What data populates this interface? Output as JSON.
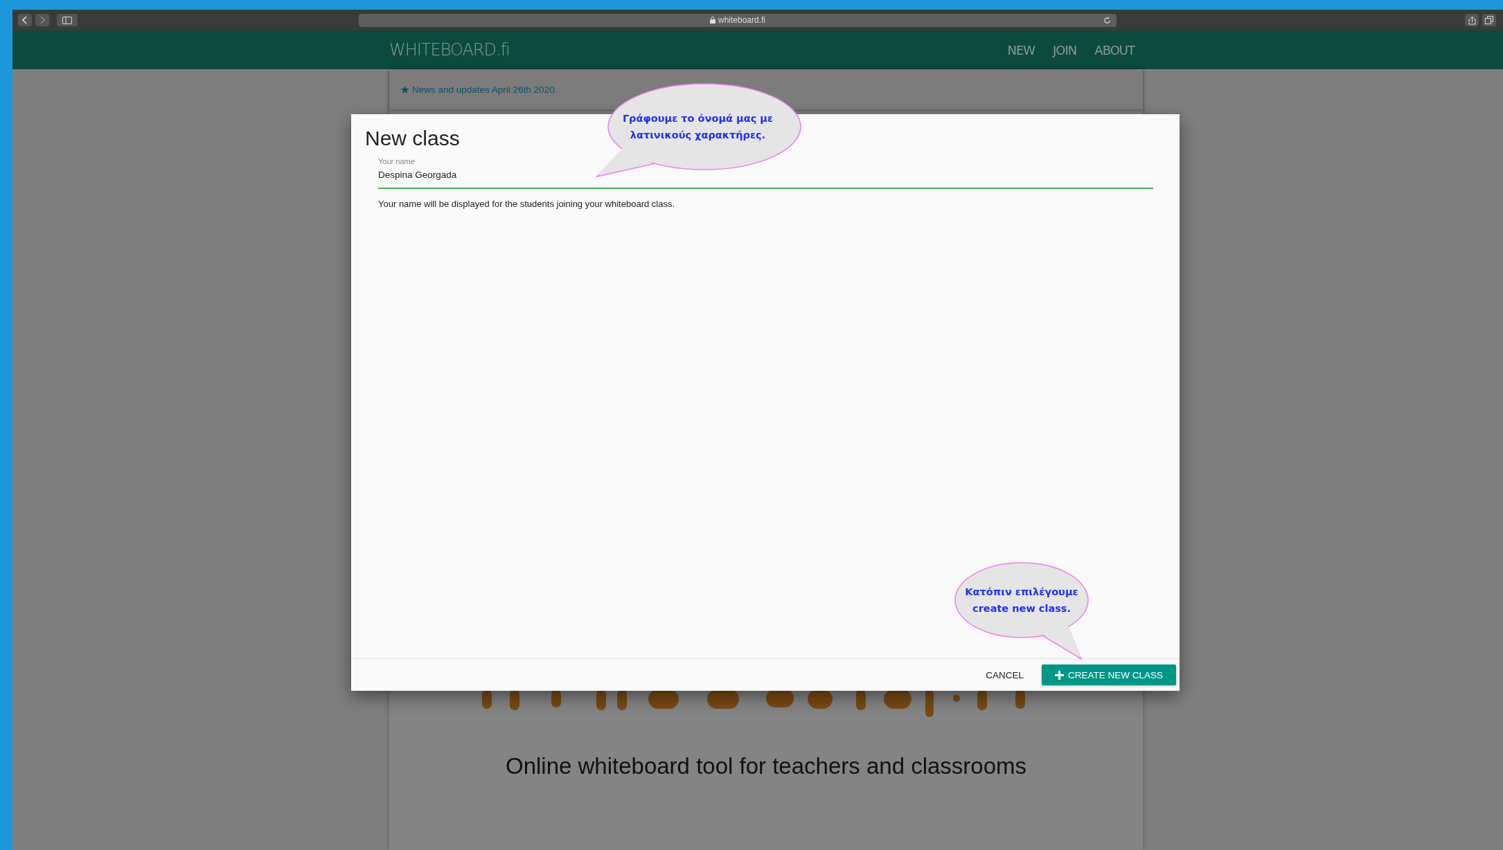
{
  "browser": {
    "url": "whiteboard.fi"
  },
  "header": {
    "logo": "WHITEBOARD.fi",
    "nav": [
      {
        "label": "NEW"
      },
      {
        "label": "JOIN"
      },
      {
        "label": "ABOUT"
      }
    ]
  },
  "news": {
    "text": "News and updates April 26th 2020."
  },
  "page": {
    "tagline": "Online whiteboard tool for teachers and classrooms"
  },
  "dialog": {
    "title": "New class",
    "field": {
      "label": "Your name",
      "value": "Despina Georgada"
    },
    "hint": "Your name will be displayed for the students joining your whiteboard class.",
    "buttons": [
      {
        "label": "CANCEL",
        "kind": "text"
      },
      {
        "label": "CREATE NEW CLASS",
        "kind": "primary"
      }
    ]
  },
  "callouts": [
    {
      "lines": [
        "Γράφουμε το όνομά μας με",
        "λατινικούς χαρακτήρες."
      ]
    },
    {
      "lines": [
        "Κατόπιν επιλέγουμε",
        "create new class."
      ]
    }
  ]
}
